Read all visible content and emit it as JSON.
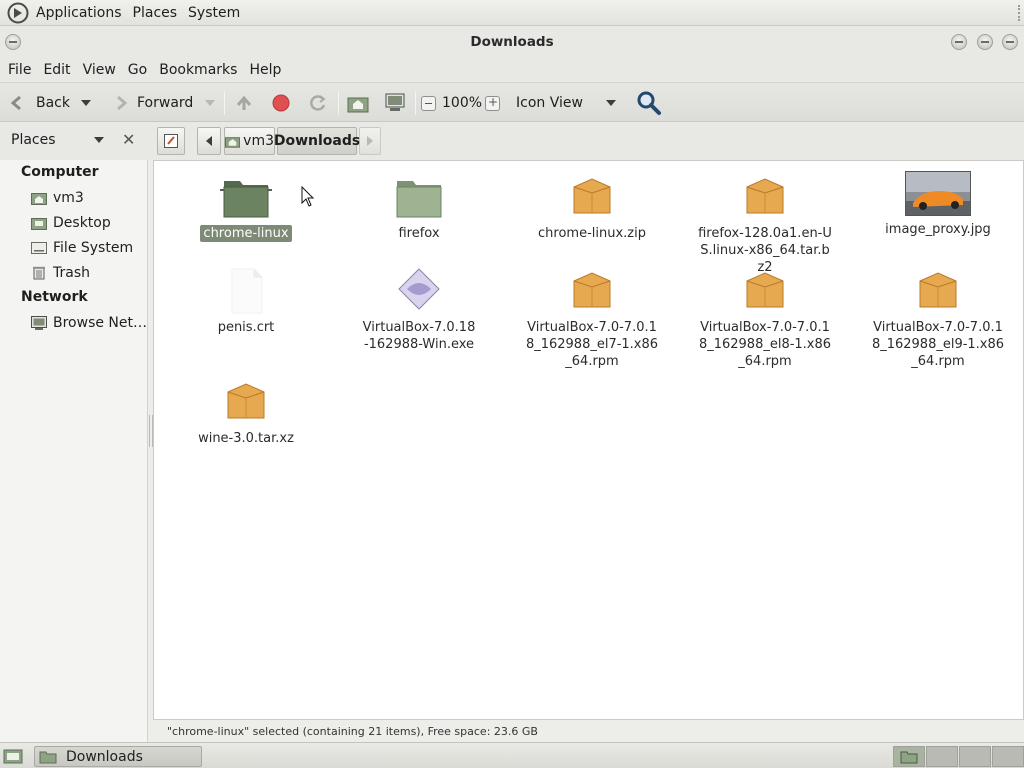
{
  "top_panel": {
    "menus": [
      "Applications",
      "Places",
      "System"
    ]
  },
  "window": {
    "title": "Downloads"
  },
  "menubar": {
    "items": [
      "File",
      "Edit",
      "View",
      "Go",
      "Bookmarks",
      "Help"
    ]
  },
  "toolbar": {
    "back_label": "Back",
    "forward_label": "Forward",
    "zoom_level": "100%",
    "view_mode": "Icon View"
  },
  "location_bar": {
    "sidebar_label": "Places",
    "path": [
      "vm3",
      "Downloads"
    ]
  },
  "sidebar": {
    "computer_heading": "Computer",
    "computer_items": [
      "vm3",
      "Desktop",
      "File System",
      "Trash"
    ],
    "network_heading": "Network",
    "network_items": [
      "Browse Net…"
    ]
  },
  "files": [
    {
      "name": "chrome-linux",
      "type": "folder-dark",
      "selected": true
    },
    {
      "name": "firefox",
      "type": "folder",
      "selected": false
    },
    {
      "name": "chrome-linux.zip",
      "type": "package",
      "selected": false
    },
    {
      "name": "firefox-128.0a1.en-US.linux-x86_64.tar.bz2",
      "type": "package",
      "selected": false
    },
    {
      "name": "image_proxy.jpg",
      "type": "image",
      "selected": false
    },
    {
      "name": "penis.crt",
      "type": "blank",
      "selected": false
    },
    {
      "name": "VirtualBox-7.0.18-162988-Win.exe",
      "type": "exe",
      "selected": false
    },
    {
      "name": "VirtualBox-7.0-7.0.18_162988_el7-1.x86_64.rpm",
      "type": "package",
      "selected": false
    },
    {
      "name": "VirtualBox-7.0-7.0.18_162988_el8-1.x86_64.rpm",
      "type": "package",
      "selected": false
    },
    {
      "name": "VirtualBox-7.0-7.0.18_162988_el9-1.x86_64.rpm",
      "type": "package",
      "selected": false
    },
    {
      "name": "wine-3.0.tar.xz",
      "type": "package",
      "selected": false
    }
  ],
  "statusbar": {
    "text": "\"chrome-linux\" selected (containing 21 items), Free space: 23.6 GB"
  },
  "taskbar": {
    "task_label": "Downloads"
  },
  "colors": {
    "selection": "#7c8a76",
    "folder": "#8ea383",
    "package": "#e7a94f"
  }
}
